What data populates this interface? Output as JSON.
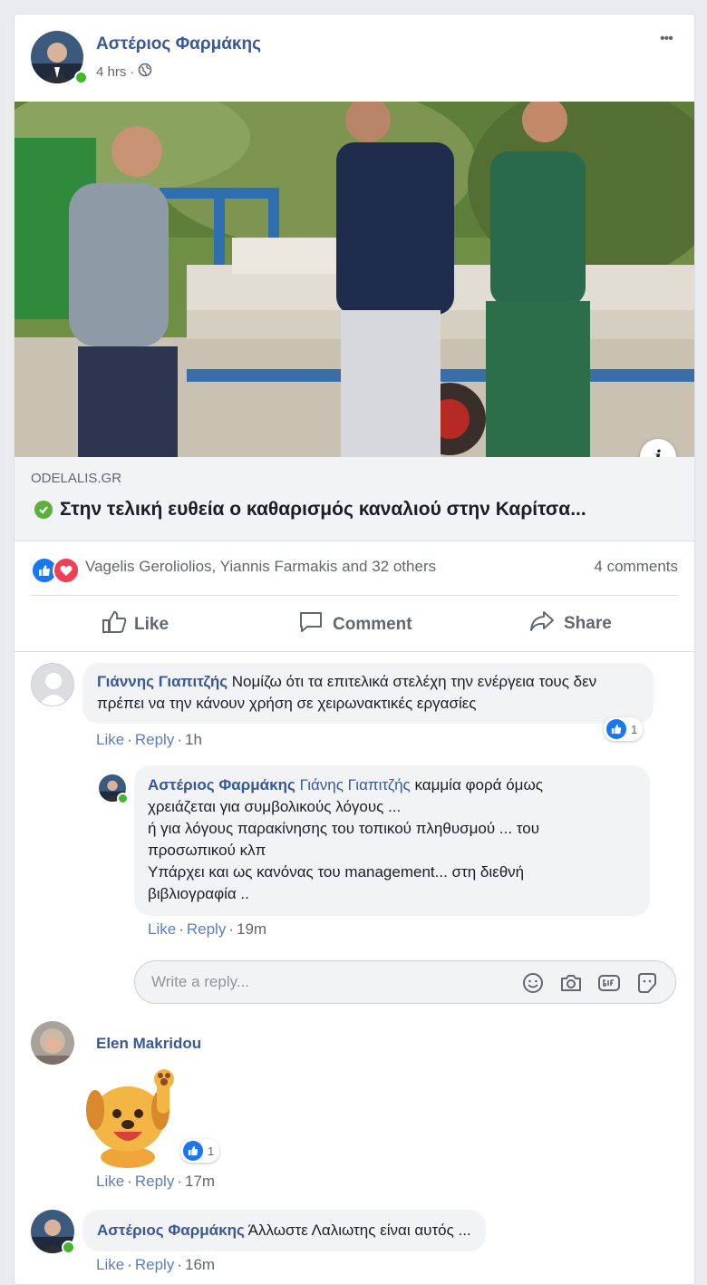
{
  "post": {
    "author": "Αστέριος Φαρμάκης",
    "time": "4 hrs",
    "dot": "·",
    "more": "•••",
    "link_domain": "ODELALIS.GR",
    "link_title": "Στην τελική ευθεία ο καθαρισμός καναλιού στην Καρίτσα...",
    "info": "i"
  },
  "reactions": {
    "summary": "Vagelis Geroliolios, Yiannis Farmakis and 32 others",
    "comments": "4 comments"
  },
  "buttons": {
    "like": "Like",
    "comment": "Comment",
    "share": "Share"
  },
  "comments": [
    {
      "author": "Γιάννης Γιαπιτζής",
      "text": "Νομίζω ότι τα επιτελικά στελέχη την ενέργεια τους δεν πρέπει να την κάνουν χρήση σε χειρωνακτικές εργασίες",
      "like": "Like",
      "reply": "Reply",
      "time": "1h",
      "reactions": "1"
    },
    {
      "author": "Αστέριος Φαρμάκης",
      "mention": "Γιάνης Γιαπιτζής",
      "line1": "καμμία φορά όμως",
      "line2": "χρειάζεται για συμβολικούς λόγους ...",
      "line3": "ή για λόγους παρακίνησης του τοπικού πληθυσμού ... του",
      "line4": "προσωπικού κλπ",
      "line5": "Υπάρχει και ως κανόνας του management... στη διεθνή",
      "line6": "βιβλιογραφία ..",
      "like": "Like",
      "reply": "Reply",
      "time": "19m"
    },
    {
      "author": "Elen Makridou",
      "sticker": "dog-waving-sticker",
      "like": "Like",
      "reply": "Reply",
      "time": "17m",
      "reactions": "1"
    },
    {
      "author": "Αστέριος Φαρμάκης",
      "text": "Άλλωστε Λαλιωτης είναι αυτός ...",
      "like": "Like",
      "reply": "Reply",
      "time": "16m"
    }
  ],
  "reply_box": {
    "placeholder": "Write a reply..."
  },
  "colors": {
    "link": "#385898",
    "like_blue": "#1877f2",
    "love_red": "#f33e58",
    "online": "#42b72a"
  }
}
